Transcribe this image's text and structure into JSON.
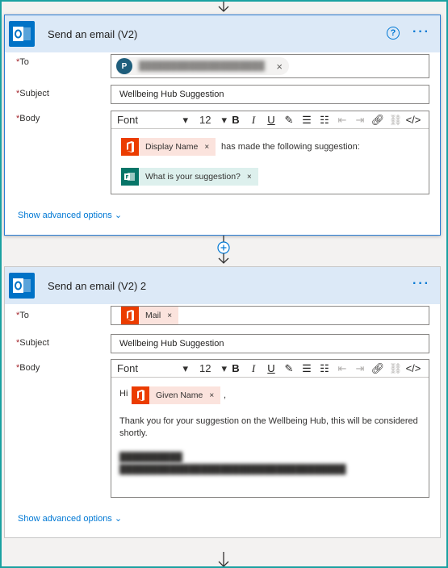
{
  "card1": {
    "title": "Send an email (V2)",
    "help": "?",
    "more": "···",
    "to": {
      "label": "To",
      "avatar_initial": "P",
      "remove": "×"
    },
    "subject": {
      "label": "Subject",
      "value": "Wellbeing Hub Suggestion"
    },
    "body": {
      "label": "Body",
      "toolbar": {
        "font": "Font",
        "size": "12"
      },
      "token1": {
        "label": "Display Name",
        "remove": "×",
        "icon": "office365-icon"
      },
      "text1": "has made the following suggestion:",
      "token2": {
        "label": "What is your suggestion?",
        "remove": "×",
        "icon": "forms-icon"
      }
    },
    "advanced": "Show advanced options"
  },
  "card2": {
    "title": "Send an email (V2) 2",
    "more": "···",
    "to": {
      "label": "To",
      "token": {
        "label": "Mail",
        "remove": "×",
        "icon": "office365-icon"
      }
    },
    "subject": {
      "label": "Subject",
      "value": "Wellbeing Hub Suggestion"
    },
    "body": {
      "label": "Body",
      "toolbar": {
        "font": "Font",
        "size": "12"
      },
      "greeting": "Hi",
      "token": {
        "label": "Given Name",
        "remove": "×",
        "icon": "office365-icon"
      },
      "comma": ",",
      "line1": "Thank you for your suggestion on the Wellbeing Hub, this will be considered",
      "line2": "shortly."
    },
    "advanced": "Show advanced options"
  },
  "required_mark": "*",
  "colors": {
    "accent": "#0078d4",
    "header_bg": "#dce9f7",
    "office_orange": "#eb3c00",
    "forms_teal": "#077568",
    "frame": "#1aa1a1"
  }
}
